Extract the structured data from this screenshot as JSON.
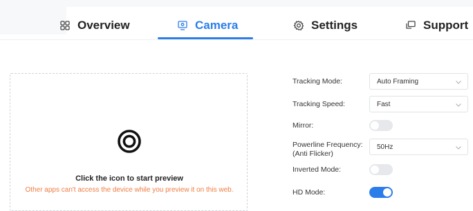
{
  "tabs": [
    {
      "label": "Overview",
      "icon": "grid-icon",
      "active": false
    },
    {
      "label": "Camera",
      "icon": "camera-monitor-icon",
      "active": true
    },
    {
      "label": "Settings",
      "icon": "gear-icon",
      "active": false
    },
    {
      "label": "Support",
      "icon": "chat-icon",
      "active": false
    }
  ],
  "preview": {
    "icon": "record-icon",
    "title": "Click the icon to start preview",
    "warning": "Other apps can't access the device while you preview it on this web."
  },
  "settings": {
    "tracking_mode": {
      "label": "Tracking Mode:",
      "value": "Auto Framing"
    },
    "tracking_speed": {
      "label": "Tracking Speed:",
      "value": "Fast"
    },
    "mirror": {
      "label": "Mirror:",
      "on": false
    },
    "powerline": {
      "label_line1": "Powerline Frequency:",
      "label_line2": "(Anti Flicker)",
      "value": "50Hz"
    },
    "inverted_mode": {
      "label": "Inverted Mode:",
      "on": false
    },
    "hd_mode": {
      "label": "HD Mode:",
      "on": true
    }
  },
  "colors": {
    "accent": "#2b7de9",
    "warning": "#f07b3f"
  }
}
